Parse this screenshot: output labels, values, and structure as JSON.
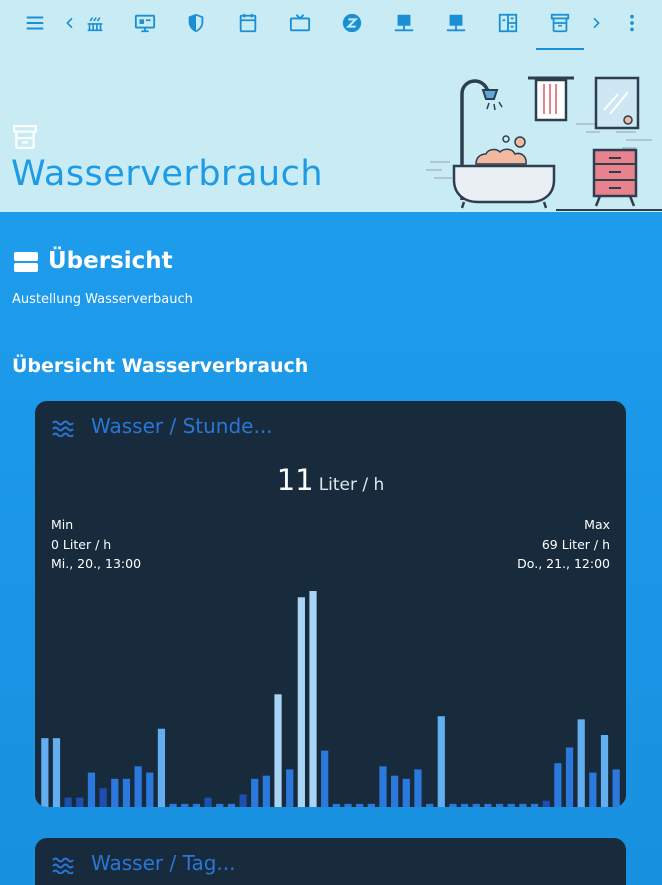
{
  "toolbar": {
    "icons": [
      "menu-icon",
      "chevron-left-icon",
      "heating-icon",
      "monitor-icon",
      "shield-icon",
      "calendar-icon",
      "tv-icon",
      "zwave-icon",
      "laptop-icon",
      "laptop-alt-icon",
      "floorplan-icon",
      "water-tab-icon",
      "chevron-right-icon",
      "more-vert-icon"
    ],
    "active_tab": "water-tab-icon"
  },
  "hero": {
    "title": "Wasserverbrauch"
  },
  "overview": {
    "title": "Übersicht",
    "subtitle": "Austellung Wasserverbauch"
  },
  "section": {
    "title": "Übersicht Wasserverbrauch"
  },
  "card_hourly": {
    "title": "Wasser / Stunde...",
    "value": "11",
    "unit": "Liter / h",
    "min_label": "Min",
    "min_value": "0 Liter / h",
    "min_time": "Mi., 20., 13:00",
    "max_label": "Max",
    "max_value": "69 Liter / h",
    "max_time": "Do., 21., 12:00"
  },
  "card_daily": {
    "title": "Wasser / Tag..."
  },
  "colors": {
    "hero_bg": "#c9ecf4",
    "accent": "#1e9be6",
    "card_bg": "#172b3c",
    "bar_dark": "#1d4fb0",
    "bar_mid": "#2b79dd",
    "bar_light": "#63aef0",
    "bar_pale": "#a9d4f6"
  },
  "chart_data": {
    "type": "bar",
    "values": [
      22,
      22,
      3,
      3,
      11,
      6,
      9,
      9,
      13,
      11,
      25,
      1,
      1,
      1,
      3,
      1,
      1,
      4,
      9,
      10,
      36,
      12,
      67,
      69,
      18,
      1,
      1,
      1,
      1,
      13,
      10,
      9,
      12,
      1,
      29,
      1,
      1,
      1,
      1,
      1,
      1,
      1,
      1,
      2,
      14,
      19,
      28,
      11,
      23,
      12
    ],
    "ylim": [
      0,
      69
    ]
  }
}
